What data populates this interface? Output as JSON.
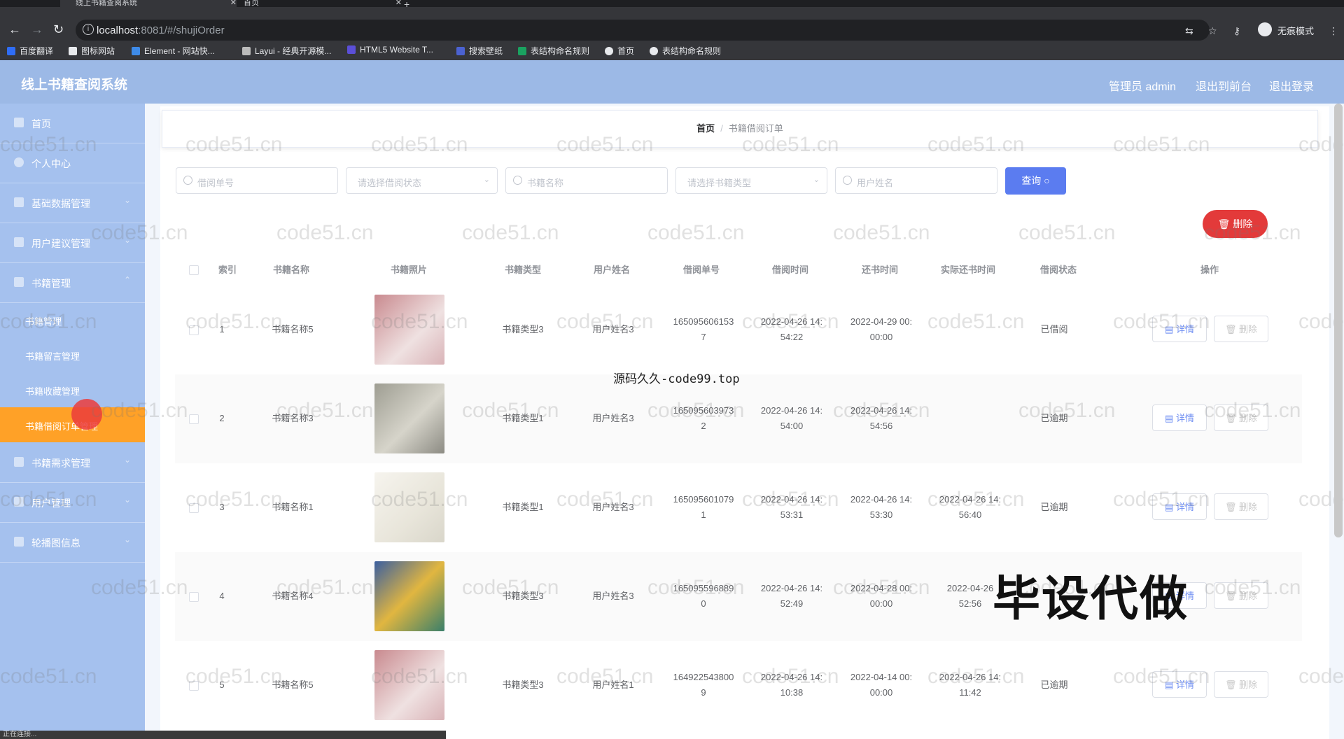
{
  "browser": {
    "tabs": [
      {
        "label": "线上书籍查阅系统"
      },
      {
        "label": "首页"
      }
    ],
    "url_host": "localhost",
    "url_path": ":8081/#/shujiOrder",
    "incognito_label": "无痕模式",
    "bookmarks": [
      "百度翻译",
      "图标网站",
      "Element - 网站快...",
      "Layui - 经典开源模...",
      "HTML5 Website T...",
      "搜索壁纸",
      "表结构命名规则",
      "首页",
      "表结构命名规则"
    ]
  },
  "header": {
    "title": "线上书籍查阅系统",
    "admin": "管理员 admin",
    "front": "退出到前台",
    "logout": "退出登录"
  },
  "sidebar": {
    "items": [
      {
        "label": "首页"
      },
      {
        "label": "个人中心"
      },
      {
        "label": "基础数据管理"
      },
      {
        "label": "用户建议管理"
      },
      {
        "label": "书籍管理"
      }
    ],
    "subitems": [
      {
        "label": "书籍管理"
      },
      {
        "label": "书籍留言管理"
      },
      {
        "label": "书籍收藏管理"
      },
      {
        "label": "书籍借阅订单管理"
      }
    ],
    "items2": [
      {
        "label": "书籍需求管理"
      },
      {
        "label": "用户管理"
      },
      {
        "label": "轮播图信息"
      }
    ]
  },
  "breadcrumb": {
    "home": "首页",
    "sep": "/",
    "current": "书籍借阅订单"
  },
  "search": {
    "order_no": "借阅单号",
    "status": "请选择借阅状态",
    "book_name": "书籍名称",
    "book_type": "请选择书籍类型",
    "user_name": "用户姓名",
    "query": "查询",
    "delete": "删除"
  },
  "table": {
    "headers": [
      "索引",
      "书籍名称",
      "书籍照片",
      "书籍类型",
      "用户姓名",
      "借阅单号",
      "借阅时间",
      "还书时间",
      "实际还书时间",
      "借阅状态",
      "操作"
    ],
    "detail_label": "详情",
    "delete_label": "删除",
    "rows": [
      {
        "idx": "1",
        "name": "书籍名称5",
        "type": "书籍类型3",
        "user": "用户姓名3",
        "order_a": "165095606153",
        "order_b": "7",
        "borrow_a": "2022-04-26 14:",
        "borrow_b": "54:22",
        "return_a": "2022-04-29 00:",
        "return_b": "00:00",
        "actual_a": "",
        "actual_b": "",
        "status": "已借阅"
      },
      {
        "idx": "2",
        "name": "书籍名称3",
        "type": "书籍类型1",
        "user": "用户姓名3",
        "order_a": "165095603973",
        "order_b": "2",
        "borrow_a": "2022-04-26 14:",
        "borrow_b": "54:00",
        "return_a": "2022-04-26 14:",
        "return_b": "54:56",
        "actual_a": "",
        "actual_b": "",
        "status": "已逾期"
      },
      {
        "idx": "3",
        "name": "书籍名称1",
        "type": "书籍类型1",
        "user": "用户姓名3",
        "order_a": "165095601079",
        "order_b": "1",
        "borrow_a": "2022-04-26 14:",
        "borrow_b": "53:31",
        "return_a": "2022-04-26 14:",
        "return_b": "53:30",
        "actual_a": "2022-04-26 14:",
        "actual_b": "56:40",
        "status": "已逾期"
      },
      {
        "idx": "4",
        "name": "书籍名称4",
        "type": "书籍类型3",
        "user": "用户姓名3",
        "order_a": "165095596889",
        "order_b": "0",
        "borrow_a": "2022-04-26 14:",
        "borrow_b": "52:49",
        "return_a": "2022-04-28 00:",
        "return_b": "00:00",
        "actual_a": "2022-04-26",
        "actual_b": "52:56",
        "status": ""
      },
      {
        "idx": "5",
        "name": "书籍名称5",
        "type": "书籍类型3",
        "user": "用户姓名1",
        "order_a": "164922543800",
        "order_b": "9",
        "borrow_a": "2022-04-26 14:",
        "borrow_b": "10:38",
        "return_a": "2022-04-14 00:",
        "return_b": "00:00",
        "actual_a": "2022-04-26 14:",
        "actual_b": "11:42",
        "status": "已逾期"
      }
    ]
  },
  "overlay": {
    "source": "源码久久-code99.top",
    "ad": "毕设代做",
    "watermark": "code51.cn",
    "status": "正在连接..."
  },
  "colors": {
    "header": "#9cb9e6",
    "sidebar": "#a5c1ee",
    "active": "#ffa127",
    "primary": "#5b7cf0",
    "danger": "#e33a3a"
  }
}
